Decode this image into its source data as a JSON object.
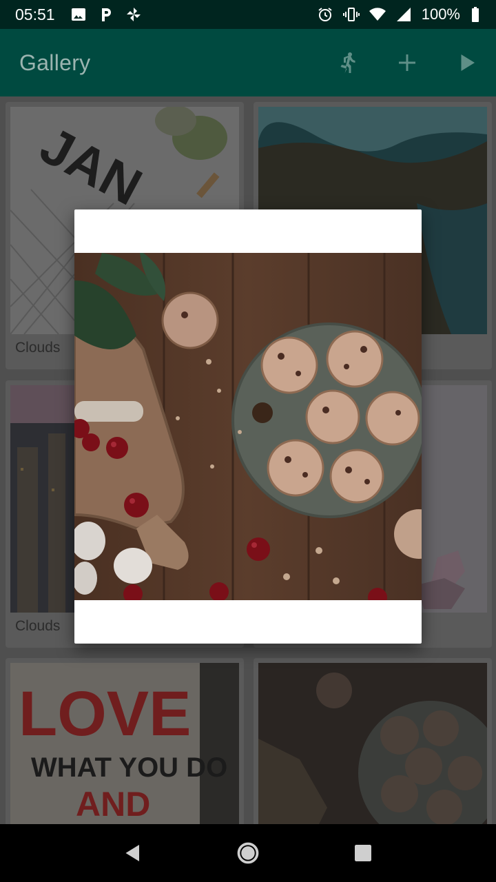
{
  "status_bar": {
    "time": "05:51",
    "battery_text": "100%",
    "left_icons": [
      "image-icon",
      "parking-icon",
      "pinwheel-icon"
    ],
    "right_icons": [
      "alarm-icon",
      "vibrate-icon",
      "wifi-icon",
      "signal-icon",
      "battery-icon"
    ]
  },
  "app_bar": {
    "title": "Gallery",
    "background": "#004a40",
    "actions": [
      "run-icon",
      "add-icon",
      "play-icon"
    ]
  },
  "gallery": {
    "cards": [
      {
        "caption": "Clouds",
        "image": "calendar-photo"
      },
      {
        "caption": "",
        "image": "aerial-coast-photo"
      },
      {
        "caption": "Clouds",
        "image": "city-skyline-photo"
      },
      {
        "caption": "",
        "image": "flowers-photo"
      },
      {
        "caption": "",
        "image": "love-sign-photo"
      },
      {
        "caption": "",
        "image": "cookies-photo"
      }
    ]
  },
  "dialog": {
    "image": "cookies-photo"
  },
  "nav_bar": {
    "buttons": [
      "back-icon",
      "home-icon",
      "recents-icon"
    ]
  }
}
